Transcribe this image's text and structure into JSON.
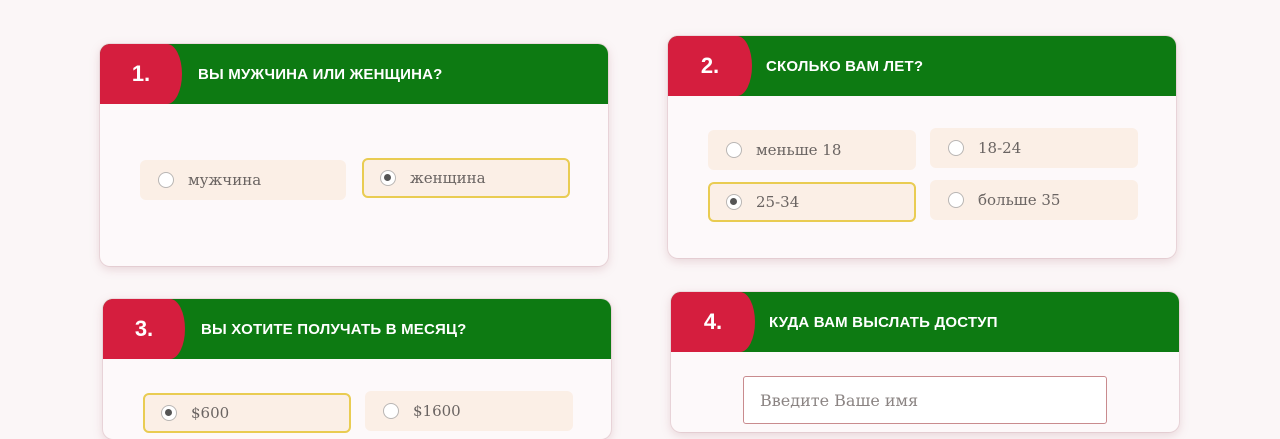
{
  "questions": [
    {
      "number": "1.",
      "title": "ВЫ МУЖЧИНА ИЛИ ЖЕНЩИНА?",
      "options": [
        "мужчина",
        "женщина"
      ],
      "selected": "женщина"
    },
    {
      "number": "2.",
      "title": "СКОЛЬКО ВАМ ЛЕТ?",
      "options": [
        "меньше 18",
        "18-24",
        "25-34",
        "больше 35"
      ],
      "selected": "25-34"
    },
    {
      "number": "3.",
      "title": "ВЫ ХОТИТЕ ПОЛУЧАТЬ В МЕСЯЦ?",
      "options": [
        "$600",
        "$1600"
      ],
      "selected": "$600"
    },
    {
      "number": "4.",
      "title": "КУДА ВАМ ВЫСЛАТЬ ДОСТУП",
      "name_placeholder": "Введите Ваше имя"
    }
  ],
  "colors": {
    "header_green": "#0d7a12",
    "number_red": "#d51e3e",
    "option_bg": "#fbefe6",
    "selected_border": "#e9cc52"
  }
}
